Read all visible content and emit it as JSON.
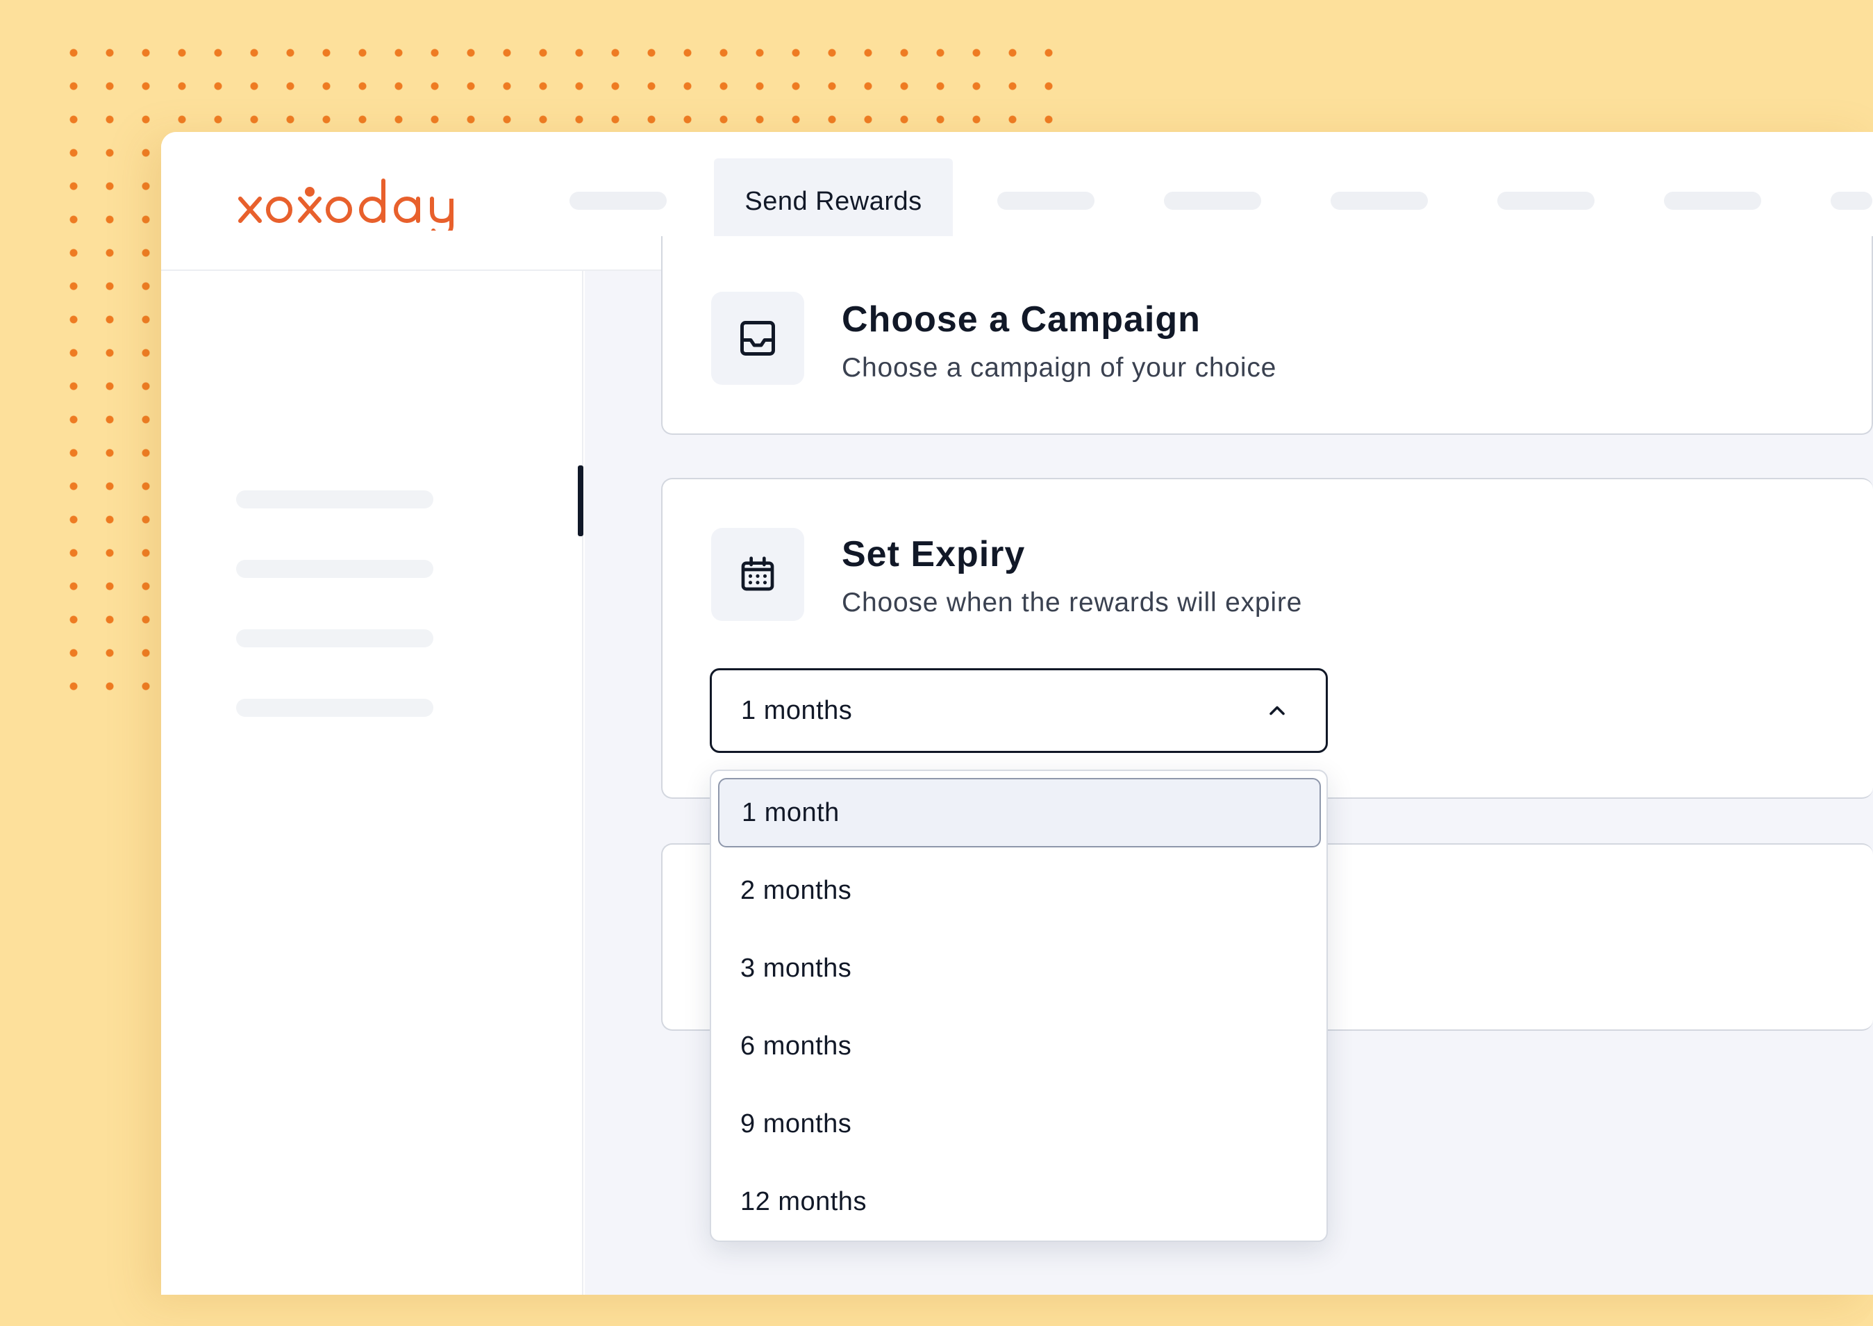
{
  "brand": {
    "name": "xoxoday",
    "color": "#e8602c"
  },
  "nav": {
    "active_label": "Send Rewards"
  },
  "campaign_card": {
    "icon": "inbox-icon",
    "title": "Choose a Campaign",
    "subtitle": "Choose a campaign of your choice"
  },
  "expiry_card": {
    "icon": "calendar-icon",
    "title": "Set Expiry",
    "subtitle": "Choose when the rewards will expire",
    "select_value": "1 months",
    "options": [
      "1 month",
      "2 months",
      "3 months",
      "6 months",
      "9 months",
      "12 months"
    ],
    "highlighted_option": "1 month"
  },
  "colors": {
    "background": "#fde09b",
    "dots": "#ee7b22",
    "text_dark": "#111827"
  }
}
